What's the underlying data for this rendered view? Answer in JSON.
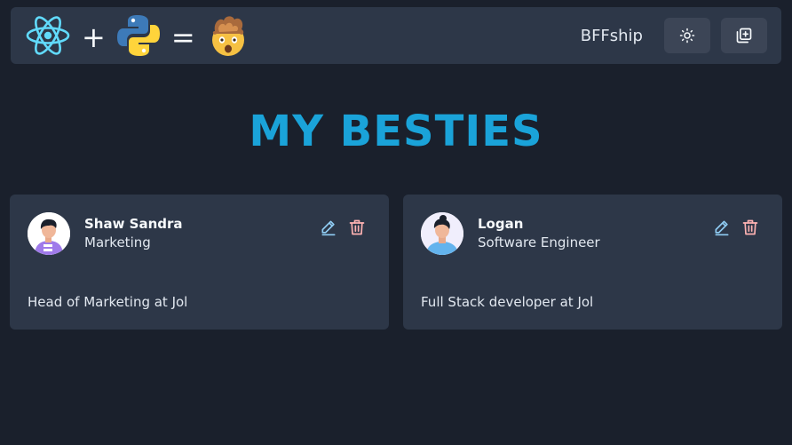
{
  "navbar": {
    "logo": {
      "react_icon": "react-logo-icon",
      "plus": "+",
      "python_icon": "python-logo-icon",
      "equals": "=",
      "result_icon": "exploding-head-emoji"
    },
    "brand": "BFFship",
    "theme_toggle_icon": "sun-icon",
    "add_friend_icon": "add-copy-icon"
  },
  "heading": "MY BESTIES",
  "friends": [
    {
      "name": "Shaw Sandra",
      "role": "Marketing",
      "description": "Head of Marketing at Jol",
      "edit_icon": "pencil-icon",
      "delete_icon": "trash-icon"
    },
    {
      "name": "Logan",
      "role": "Software Engineer",
      "description": "Full Stack developer at Jol",
      "edit_icon": "pencil-icon",
      "delete_icon": "trash-icon"
    }
  ],
  "colors": {
    "background": "#1a202c",
    "surface": "#2d3748",
    "heading_gradient_start": "#0bc5ea",
    "heading_gradient_end": "#2b6cb0",
    "edit_icon": "#90cdf4",
    "delete_icon": "#feb2b2"
  }
}
